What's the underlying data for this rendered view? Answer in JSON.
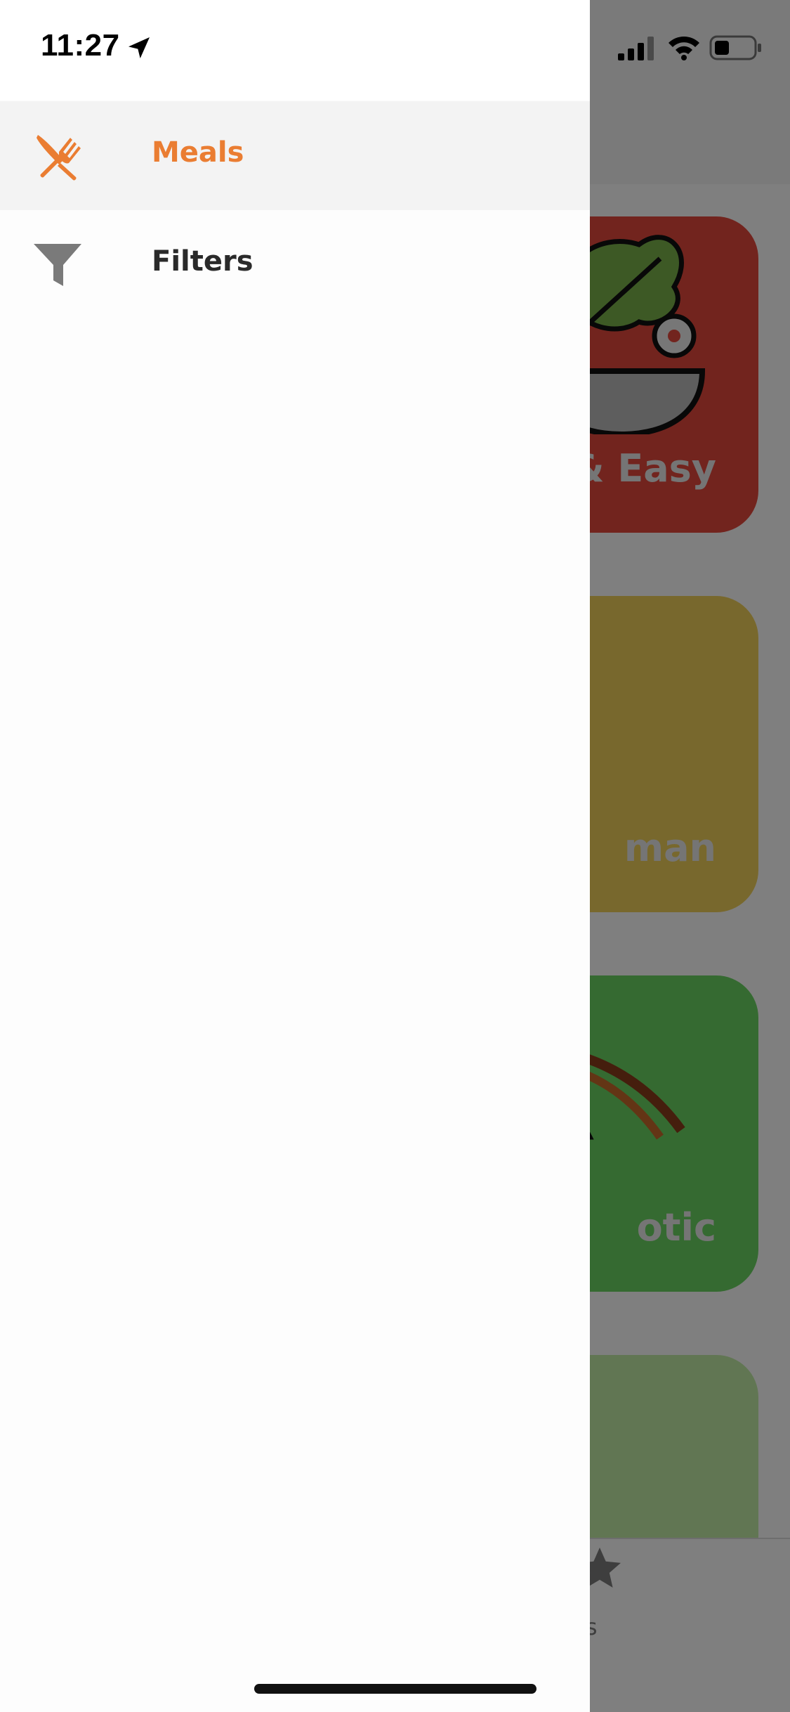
{
  "status_bar": {
    "time": "11:27",
    "icons": [
      "location-arrow-icon",
      "signal-icon",
      "wifi-icon",
      "battery-icon"
    ]
  },
  "drawer": {
    "items": [
      {
        "label": "Meals",
        "icon": "utensils-icon",
        "active": true
      },
      {
        "label": "Filters",
        "icon": "filter-icon",
        "active": false
      }
    ],
    "colors": {
      "accent": "#ea7d32",
      "active_background": "#f3f3f3",
      "icon_inactive": "#7a7a7a"
    }
  },
  "background": {
    "categories": [
      {
        "title": "& Easy",
        "color": "#e5493d"
      },
      {
        "title": "man",
        "color": "#f1d15a"
      },
      {
        "title": "otic",
        "color": "#6bd562"
      },
      {
        "title": "",
        "color": "#c2eca6"
      }
    ],
    "tab_bar": {
      "favorites_label": "orites",
      "favorites_icon": "star-icon"
    }
  }
}
